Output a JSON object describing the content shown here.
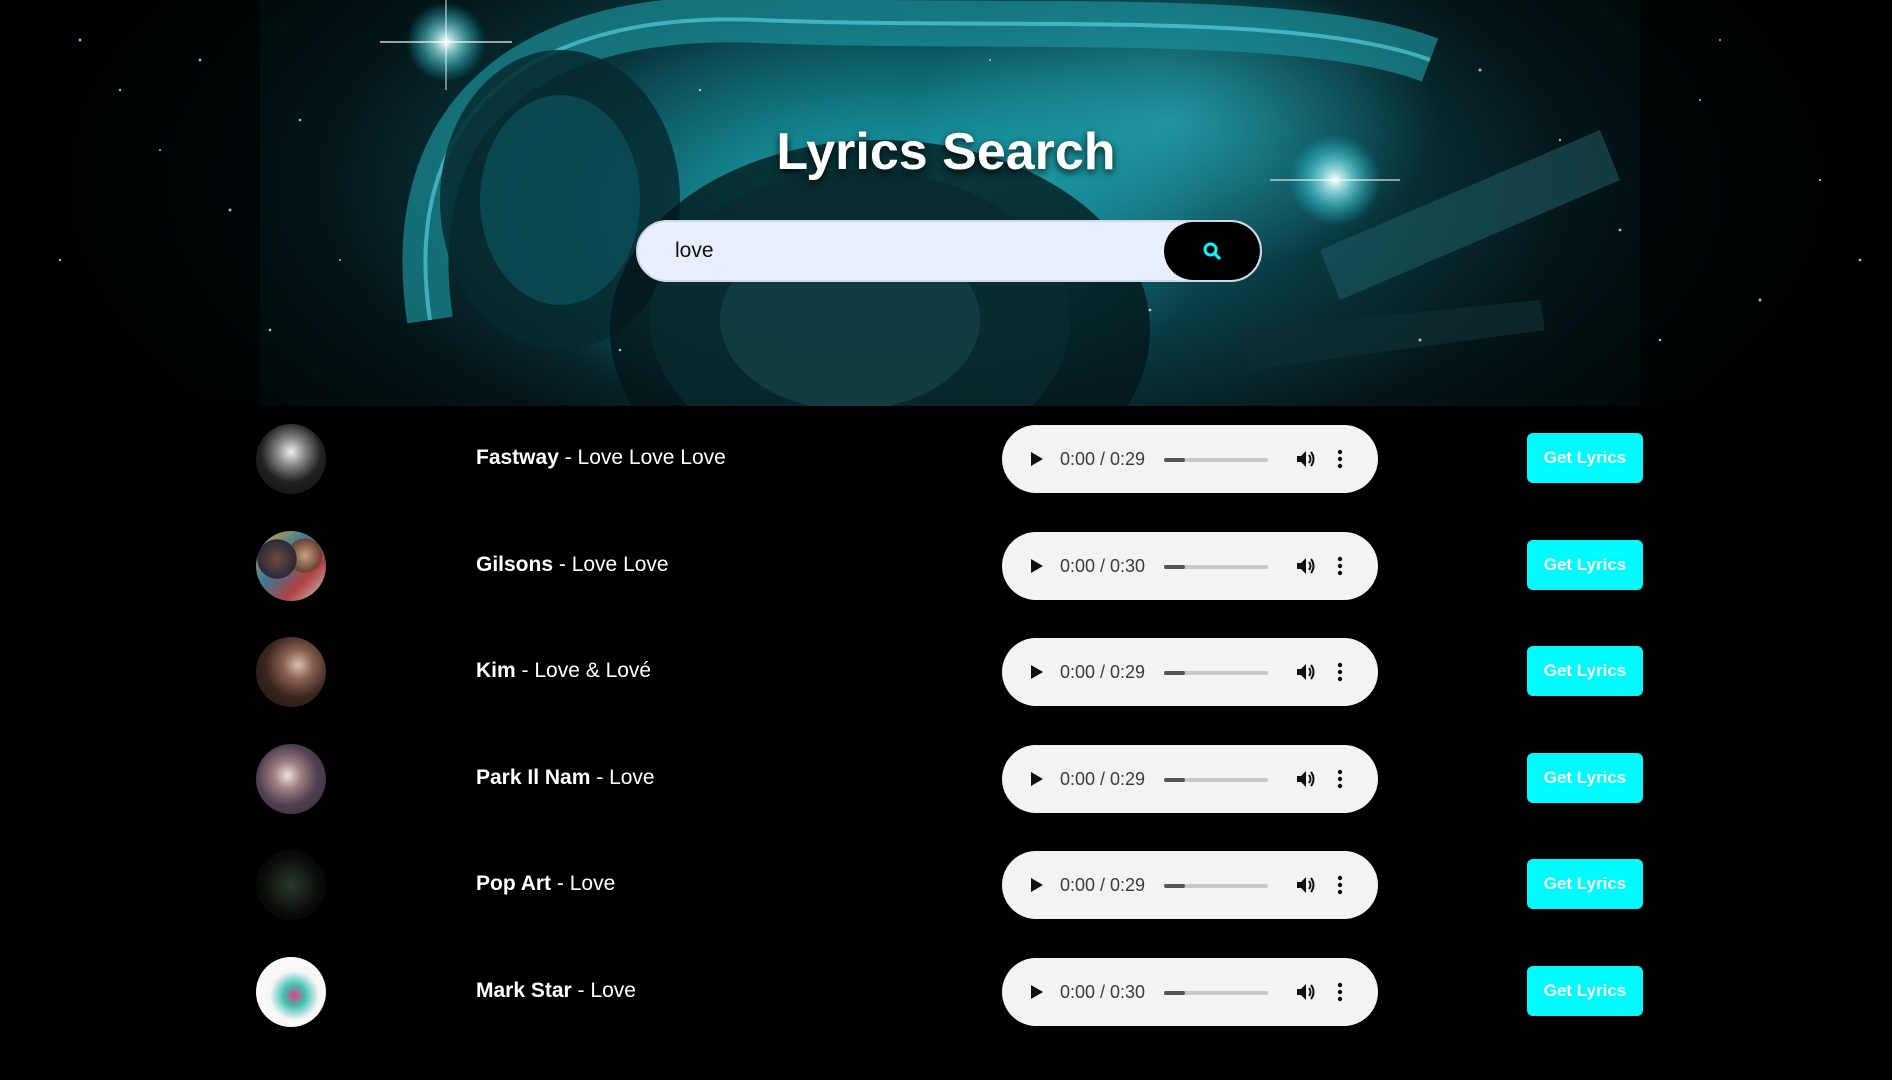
{
  "header": {
    "title": "Lyrics Search"
  },
  "search": {
    "value": "love",
    "button_icon": "search-icon"
  },
  "colors": {
    "accent": "#00fbff",
    "background": "#000000",
    "hero_teal": "#0d6d78",
    "player_bg": "#f1f3f4"
  },
  "results": [
    {
      "artist": "Fastway",
      "separator": " - ",
      "title": "Love Love Love",
      "time": "0:00 / 0:29",
      "button": "Get Lyrics"
    },
    {
      "artist": "Gilsons",
      "separator": " - ",
      "title": "Love Love",
      "time": "0:00 / 0:30",
      "button": "Get Lyrics"
    },
    {
      "artist": "Kim",
      "separator": " - ",
      "title": "Love & Lové",
      "time": "0:00 / 0:29",
      "button": "Get Lyrics"
    },
    {
      "artist": "Park Il Nam",
      "separator": " - ",
      "title": "Love",
      "time": "0:00 / 0:29",
      "button": "Get Lyrics"
    },
    {
      "artist": "Pop Art",
      "separator": " - ",
      "title": "Love",
      "time": "0:00 / 0:29",
      "button": "Get Lyrics"
    },
    {
      "artist": "Mark Star",
      "separator": " - ",
      "title": "Love",
      "time": "0:00 / 0:30",
      "button": "Get Lyrics"
    }
  ]
}
